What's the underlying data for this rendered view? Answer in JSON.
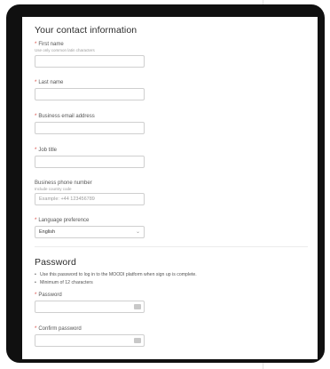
{
  "contact": {
    "heading": "Your contact information",
    "first_name": {
      "label": "First name",
      "hint": "Use only common latin characters"
    },
    "last_name": {
      "label": "Last name"
    },
    "email": {
      "label": "Business email address"
    },
    "job_title": {
      "label": "Job title"
    },
    "phone": {
      "label": "Business phone number",
      "hint": "Include country code",
      "placeholder": "Example: +44 123456789"
    },
    "language": {
      "label": "Language preference",
      "value": "English"
    }
  },
  "password": {
    "heading": "Password",
    "rules": [
      "Use this password to log in to the MOODI platform when sign up is complete.",
      "Minimum of 12 characters"
    ],
    "password_label": "Password",
    "confirm_label": "Confirm password"
  },
  "required_mark": "*"
}
